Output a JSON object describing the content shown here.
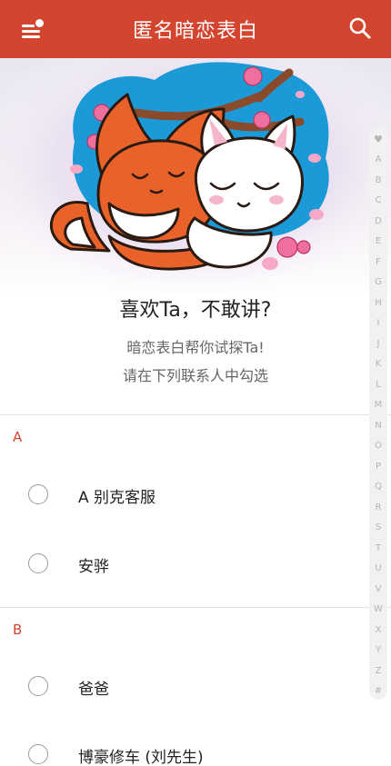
{
  "colors": {
    "primary": "#d4452f",
    "text": "#222222",
    "subtext": "#666666",
    "radio_border": "#9a9a9a",
    "index_text": "#b5b5b5"
  },
  "header": {
    "title": "匿名暗恋表白",
    "menu_icon": "menu-with-badge-icon",
    "search_icon": "search-icon"
  },
  "banner": {
    "image": "hugging-fox-and-cat-illustration"
  },
  "intro": {
    "headline": "喜欢Ta，不敢讲?",
    "line1": "暗恋表白帮你试探Ta!",
    "line2": "请在下列联系人中勾选"
  },
  "sections": [
    {
      "letter": "A",
      "contacts": [
        {
          "name": "A 别克客服",
          "selected": false
        },
        {
          "name": "安骅",
          "selected": false
        }
      ]
    },
    {
      "letter": "B",
      "contacts": [
        {
          "name": "爸爸",
          "selected": false
        },
        {
          "name": "博豪修车 (刘先生)",
          "selected": false
        }
      ]
    }
  ],
  "index_bar": {
    "top_icon": "heart-icon",
    "letters": [
      "A",
      "B",
      "C",
      "D",
      "E",
      "F",
      "G",
      "H",
      "I",
      "J",
      "K",
      "L",
      "M",
      "N",
      "O",
      "P",
      "Q",
      "R",
      "S",
      "T",
      "U",
      "V",
      "W",
      "X",
      "Y",
      "Z",
      "#"
    ]
  }
}
